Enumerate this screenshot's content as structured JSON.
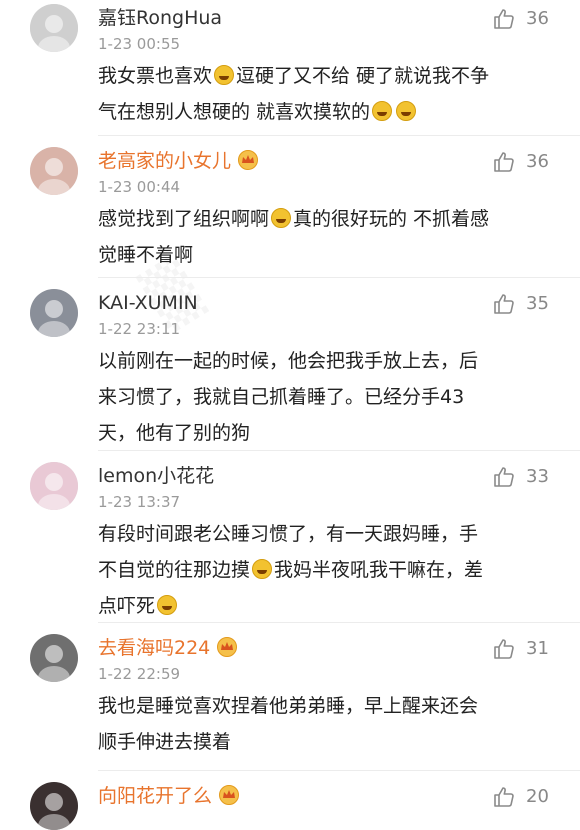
{
  "comments": [
    {
      "name": "嘉钰RongHua",
      "vip": false,
      "time": "1-23 00:55",
      "likes": "36",
      "lines": [
        [
          "我女票也喜欢",
          "laugh-emoji",
          "逗硬了又不给  硬了就说我不争"
        ],
        [
          "气在想别人想硬的  就喜欢摸软的",
          "laugh-emoji",
          "laugh-emoji"
        ]
      ]
    },
    {
      "name": "老高家的小女儿",
      "vip": true,
      "time": "1-23 00:44",
      "likes": "36",
      "lines": [
        [
          "感觉找到了组织啊啊",
          "laugh-emoji",
          "真的很好玩的  不抓着感"
        ],
        [
          "觉睡不着啊"
        ]
      ]
    },
    {
      "name": "KAI-XUMIN",
      "vip": false,
      "time": "1-22 23:11",
      "likes": "35",
      "lines": [
        [
          "以前刚在一起的时候，他会把我手放上去，后"
        ],
        [
          "来习惯了，我就自己抓着睡了。已经分手43"
        ],
        [
          "天，他有了别的狗"
        ]
      ]
    },
    {
      "name": "lemon小花花",
      "vip": false,
      "time": "1-23 13:37",
      "likes": "33",
      "lines": [
        [
          "有段时间跟老公睡习惯了，有一天跟妈睡，手"
        ],
        [
          "不自觉的往那边摸",
          "laugh-emoji",
          "我妈半夜吼我干嘛在，差"
        ],
        [
          "点吓死",
          "laugh-emoji"
        ]
      ]
    },
    {
      "name": "去看海吗224",
      "vip": true,
      "time": "1-22 22:59",
      "likes": "31",
      "lines": [
        [
          "我也是睡觉喜欢捏着他弟弟睡，早上醒来还会"
        ],
        [
          "顺手伸进去摸着"
        ]
      ]
    },
    {
      "name": "向阳花开了么",
      "vip": true,
      "time": "",
      "likes": "20",
      "lines": []
    }
  ],
  "icons": {
    "like": "thumbs-up-icon",
    "vip": "crown-icon",
    "emoji": "laugh-emoji"
  },
  "colors": {
    "vip_name": "#e8742d",
    "plain_name": "#333333",
    "meta": "#9a9a9a"
  }
}
